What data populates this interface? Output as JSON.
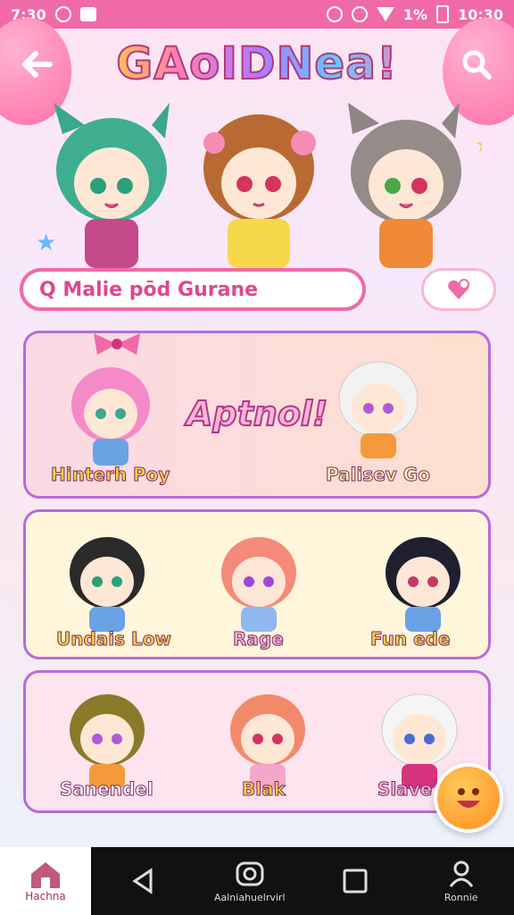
{
  "status_bar": {
    "time": "7:30",
    "battery": "1%",
    "clock_right": "10:30"
  },
  "header": {
    "title": "GAoIDNea!"
  },
  "search": {
    "text": "Q Malie pōd Gurane"
  },
  "featured": {
    "banner_text": "Aptnol!",
    "left_label": "Hinterh Poy",
    "right_label": "Palisev Go"
  },
  "row2": {
    "labels": [
      "Undais Low",
      "Rage",
      "Fun ede"
    ]
  },
  "row3": {
    "labels": [
      "Sanendel",
      "Blak",
      "Slave"
    ]
  },
  "bottom_nav": {
    "home_label": "Hachna",
    "center_label": "Aalniahuelrvirl",
    "profile_label": "Ronnie"
  },
  "colors": {
    "accent": "#f06aa8",
    "card_border": "#b76bd8",
    "label_fill": "#ffd23f"
  }
}
